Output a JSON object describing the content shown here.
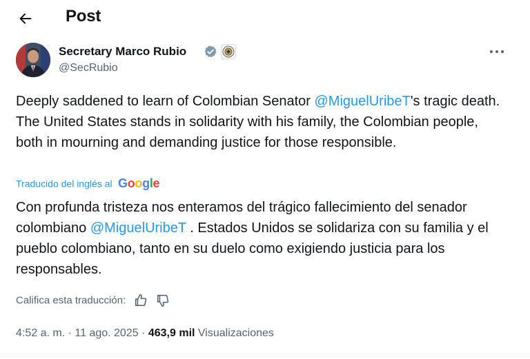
{
  "header": {
    "title": "Post"
  },
  "author": {
    "name": "Secretary Marco Rubio",
    "handle": "@SecRubio"
  },
  "tweet": {
    "text_before": "Deeply saddened to learn of Colombian Senator ",
    "mention": "@MiguelUribeT",
    "text_after": "'s tragic death. The United States stands in solidarity with his family, the Colombian people, both in mourning and demanding justice for those responsible."
  },
  "translation": {
    "label": "Traducido del inglés al",
    "provider": "Google",
    "text_before": "Con profunda tristeza nos enteramos del trágico fallecimiento del senador colombiano ",
    "mention": "@MiguelUribeT",
    "text_after": " . Estados Unidos se solidariza con su familia y el pueblo colombiano, tanto en su duelo como exigiendo justicia para los responsables.",
    "rate_label": "Califica esta traducción:"
  },
  "meta": {
    "time": "4:52 a. m.",
    "separator": "·",
    "date": "11 ago. 2025",
    "views_count": "463,9 mil",
    "views_label": "Visualizaciones"
  },
  "colors": {
    "link": "#1d9bf0",
    "secondary_text": "#536471",
    "primary_text": "#0f1419"
  },
  "icons": {
    "back": "arrow-left-icon",
    "verified": "verified-badge-icon",
    "affiliate": "state-department-seal-icon",
    "more": "more-horizontal-icon",
    "thumbs_up": "thumbs-up-icon",
    "thumbs_down": "thumbs-down-icon"
  }
}
